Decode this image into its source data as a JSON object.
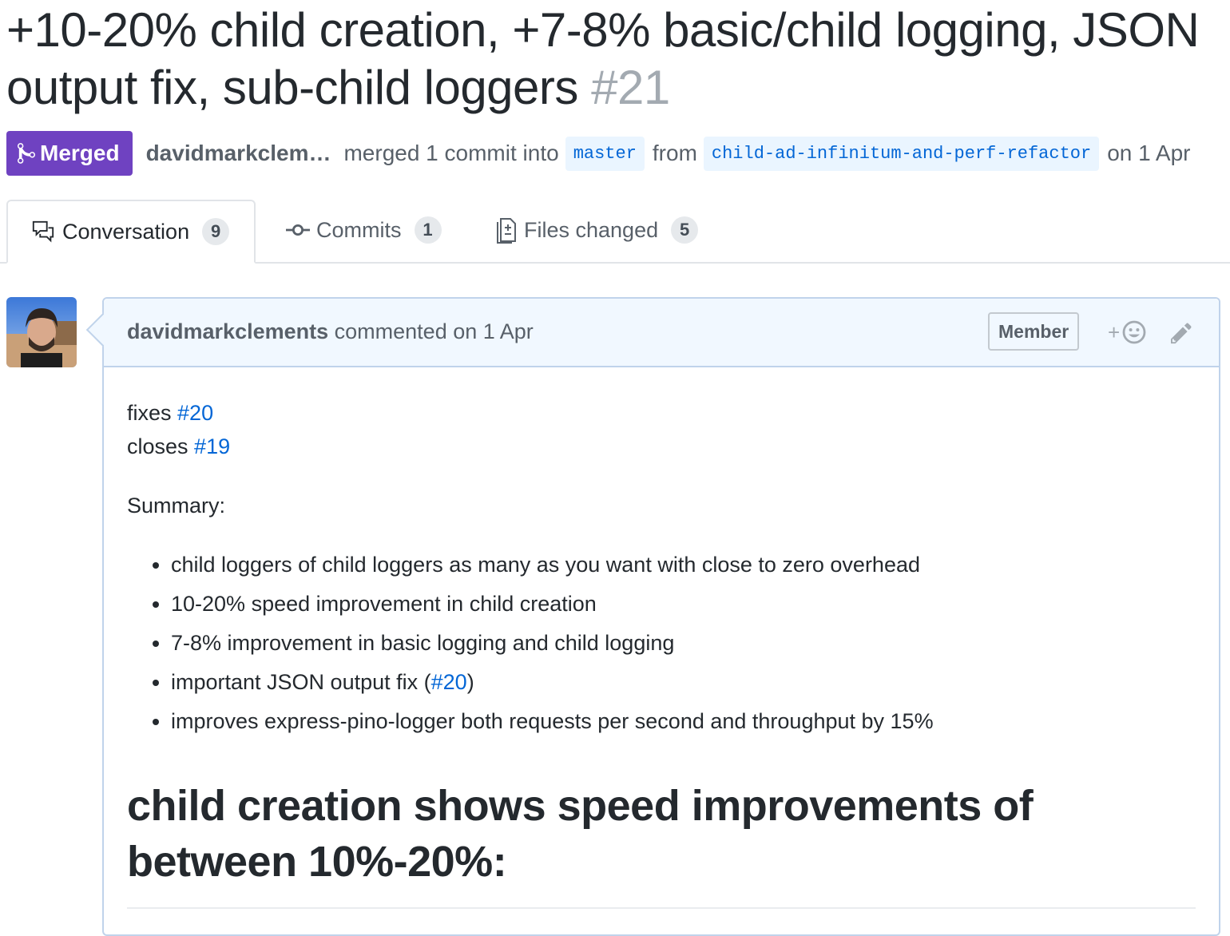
{
  "pr": {
    "title": "+10-20% child creation, +7-8% basic/child logging, JSON output fix, sub-child loggers",
    "number": "#21",
    "state": "Merged",
    "author": "davidmarkclem…",
    "merged_text": "merged 1 commit into",
    "base_branch": "master",
    "from_text": "from",
    "head_branch": "child-ad-infinitum-and-perf-refactor",
    "date_text": "on 1 Apr"
  },
  "tabs": [
    {
      "label": "Conversation",
      "count": "9",
      "icon": "comment-discussion-icon",
      "selected": true
    },
    {
      "label": "Commits",
      "count": "1",
      "icon": "git-commit-icon",
      "selected": false
    },
    {
      "label": "Files changed",
      "count": "5",
      "icon": "file-diff-icon",
      "selected": false
    }
  ],
  "comment": {
    "author": "davidmarkclements",
    "action": "commented on 1 Apr",
    "role": "Member",
    "reaction_plus": "+",
    "lines": [
      {
        "text": "fixes ",
        "link": "#20"
      },
      {
        "text": "closes ",
        "link": "#19"
      }
    ],
    "summary_label": "Summary:",
    "bullets": [
      "child loggers of child loggers as many as you want with close to zero overhead",
      "10-20% speed improvement in child creation",
      "7-8% improvement in basic logging and child logging",
      "improves express-pino-logger both requests per second and throughput by 15%"
    ],
    "bullet_json": {
      "before": "important JSON output fix (",
      "link": "#20",
      "after": ")"
    },
    "heading": "child creation shows speed improvements of between 10%-20%:"
  },
  "colors": {
    "merged": "#6f42c1",
    "link": "#0366d6",
    "comment_header": "#f1f8ff"
  }
}
